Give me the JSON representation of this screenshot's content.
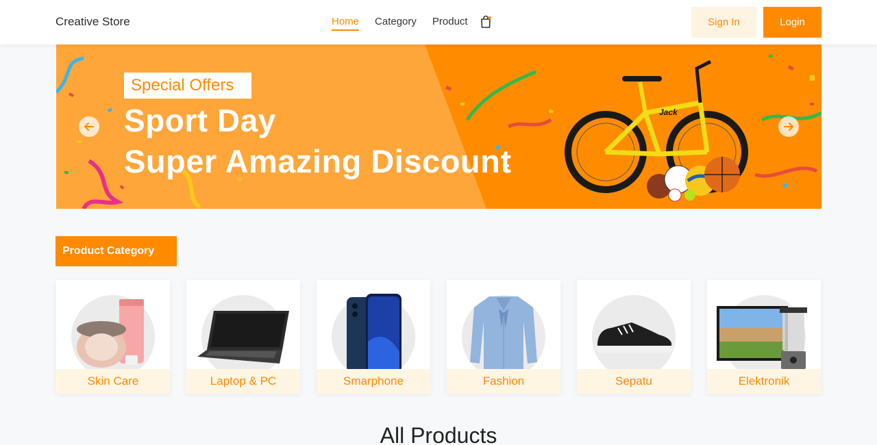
{
  "header": {
    "brand": "Creative Store",
    "nav": [
      {
        "label": "Home",
        "active": true
      },
      {
        "label": "Category",
        "active": false
      },
      {
        "label": "Product",
        "active": false
      }
    ],
    "cart_icon": "shopping-bag-icon",
    "signin_label": "Sign In",
    "login_label": "Login"
  },
  "banner": {
    "tag": "Special Offers",
    "title_line1": "Sport Day",
    "title_line2": "Super Amazing Discount",
    "bike_brand": "Jack",
    "prev_icon": "arrow-left-icon",
    "next_icon": "arrow-right-icon"
  },
  "categories_section": {
    "label": "Product Category",
    "items": [
      {
        "label": "Skin Care",
        "icon": "cosmetics-icon"
      },
      {
        "label": "Laptop & PC",
        "icon": "laptop-icon"
      },
      {
        "label": "Smarphone",
        "icon": "smartphone-icon"
      },
      {
        "label": "Fashion",
        "icon": "blouse-icon"
      },
      {
        "label": "Sepatu",
        "icon": "sneaker-icon"
      },
      {
        "label": "Elektronik",
        "icon": "tv-blender-icon"
      }
    ]
  },
  "all_products_title": "All Products",
  "colors": {
    "accent": "#ff8a00",
    "accent_light": "#fff5e3",
    "banner_light": "#ffa63a"
  }
}
